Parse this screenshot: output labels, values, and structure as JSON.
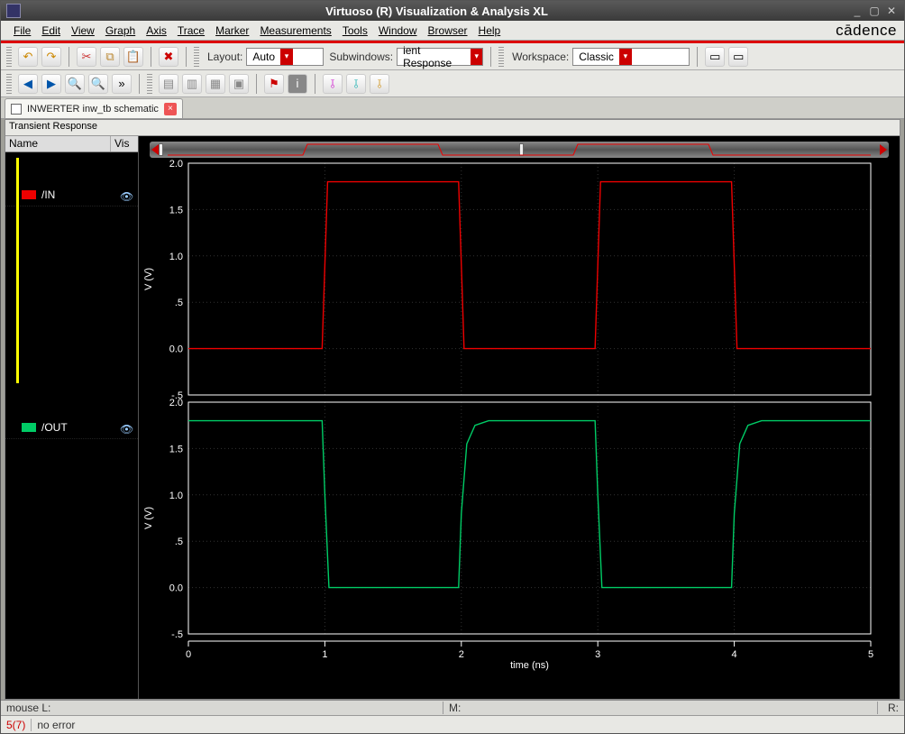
{
  "title": "Virtuoso (R) Visualization & Analysis XL",
  "menu": [
    "File",
    "Edit",
    "View",
    "Graph",
    "Axis",
    "Trace",
    "Marker",
    "Measurements",
    "Tools",
    "Window",
    "Browser",
    "Help"
  ],
  "brand": "cādence",
  "toolbar1": {
    "layout_label": "Layout:",
    "layout_value": "Auto",
    "subwindows_label": "Subwindows:",
    "subwindows_value": "ient Response",
    "workspace_label": "Workspace:",
    "workspace_value": "Classic"
  },
  "tab": {
    "label": "INWERTER inw_tb schematic"
  },
  "panel_title": "Transient Response",
  "legend": {
    "col1": "Name",
    "col2": "Vis",
    "rows": [
      {
        "name": "/IN",
        "color": "#e00"
      },
      {
        "name": "/OUT",
        "color": "#0c6"
      }
    ]
  },
  "xaxis": {
    "label": "time (ns)",
    "ticks": [
      0,
      1,
      2,
      3,
      4,
      5
    ]
  },
  "yaxis": {
    "label": "V (V)",
    "ticks": [
      -0.5,
      0,
      0.5,
      1.0,
      1.5,
      2.0
    ]
  },
  "chart_data": [
    {
      "type": "line",
      "title": "/IN",
      "xlabel": "time (ns)",
      "ylabel": "V (V)",
      "ylim": [
        -0.5,
        2.0
      ],
      "x": [
        0.0,
        0.98,
        1.02,
        1.98,
        2.02,
        2.98,
        3.02,
        3.98,
        4.02,
        5.0
      ],
      "y": [
        0.0,
        0.0,
        1.8,
        1.8,
        0.0,
        0.0,
        1.8,
        1.8,
        0.0,
        0.0
      ]
    },
    {
      "type": "line",
      "title": "/OUT",
      "xlabel": "time (ns)",
      "ylabel": "V (V)",
      "ylim": [
        -0.5,
        2.0
      ],
      "x": [
        0.0,
        0.98,
        1.0,
        1.03,
        1.98,
        2.0,
        2.04,
        2.1,
        2.2,
        2.98,
        3.0,
        3.03,
        3.98,
        4.0,
        4.04,
        4.1,
        4.2,
        5.0
      ],
      "y": [
        1.8,
        1.8,
        1.0,
        0.0,
        0.0,
        0.8,
        1.55,
        1.75,
        1.8,
        1.8,
        1.0,
        0.0,
        0.0,
        0.8,
        1.55,
        1.75,
        1.8,
        1.8
      ]
    }
  ],
  "status": {
    "mouseL": "mouse L:",
    "M": "M:",
    "R": "R:"
  },
  "errorbar": {
    "count": "5(7)",
    "msg": "no error"
  }
}
